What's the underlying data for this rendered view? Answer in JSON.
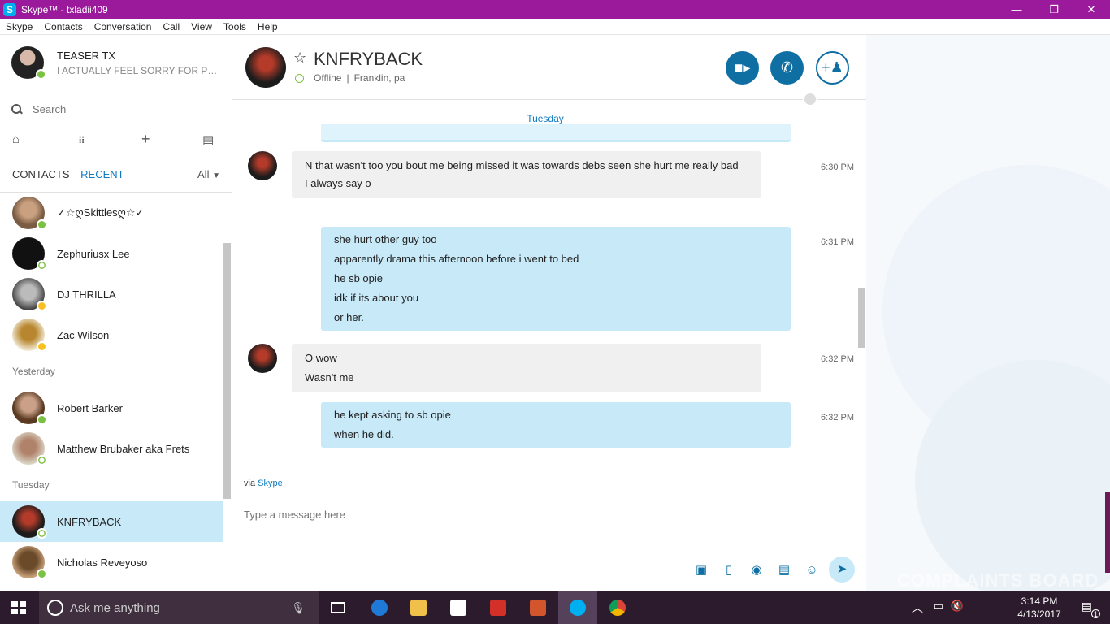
{
  "window": {
    "title": "Skype™ - txladii409",
    "controls": [
      "—",
      "❐",
      "✕"
    ]
  },
  "menu": [
    "Skype",
    "Contacts",
    "Conversation",
    "Call",
    "View",
    "Tools",
    "Help"
  ],
  "profile": {
    "name": "TEASER TX",
    "mood": "I ACTUALLY FEEL SORRY FOR PEOP..."
  },
  "search": {
    "placeholder": "Search"
  },
  "tabs": {
    "contacts": "CONTACTS",
    "recent": "RECENT",
    "filter": "All"
  },
  "contacts_recent": [
    {
      "name": "✓☆ღSkittlesღ☆✓",
      "status": "online"
    },
    {
      "name": "Zephuriusx Lee",
      "status": "offline"
    },
    {
      "name": "DJ THRILLA",
      "status": "away"
    },
    {
      "name": "Zac Wilson",
      "status": "away"
    }
  ],
  "section_yesterday": "Yesterday",
  "contacts_yesterday": [
    {
      "name": "Robert Barker",
      "status": "online"
    },
    {
      "name": "Matthew Brubaker aka Frets",
      "status": "offline"
    }
  ],
  "section_tuesday": "Tuesday",
  "contacts_tuesday": [
    {
      "name": "KNFRYBACK",
      "status": "offline"
    },
    {
      "name": "Nicholas Reveyoso",
      "status": "online"
    }
  ],
  "chat": {
    "contact_name": "KNFRYBACK",
    "status_text": "Offline",
    "location": "Franklin, pa",
    "day_label": "Tuesday",
    "messages": [
      {
        "dir": "in",
        "time": "6:30 PM",
        "lines": [
          "N that wasn't too you bout me being missed it was towards debs seen she hurt me really bad",
          "I always say o"
        ]
      },
      {
        "dir": "out",
        "time": "6:31 PM",
        "lines": [
          "she hurt other guy too",
          "apparently drama this afternoon before i went to bed",
          "he sb opie",
          "idk if its about you",
          "or her."
        ]
      },
      {
        "dir": "in",
        "time": "6:32 PM",
        "lines": [
          "O wow",
          "Wasn't me"
        ]
      },
      {
        "dir": "out",
        "time": "6:32 PM",
        "lines": [
          "he kept asking to sb opie",
          "when he did."
        ]
      }
    ],
    "via_prefix": "via",
    "via_link": "Skype",
    "compose_placeholder": "Type a message here"
  },
  "taskbar": {
    "search_placeholder": "Ask me anything",
    "time": "3:14 PM",
    "date": "4/13/2017",
    "notifications": "1"
  },
  "watermark": "COMPLAINTS BOARD",
  "colors": {
    "titlebar": "#9b1a9b",
    "accent": "#0f6fa3",
    "selected": "#c7e9f8",
    "online": "#7cc242",
    "away": "#f8c121"
  }
}
